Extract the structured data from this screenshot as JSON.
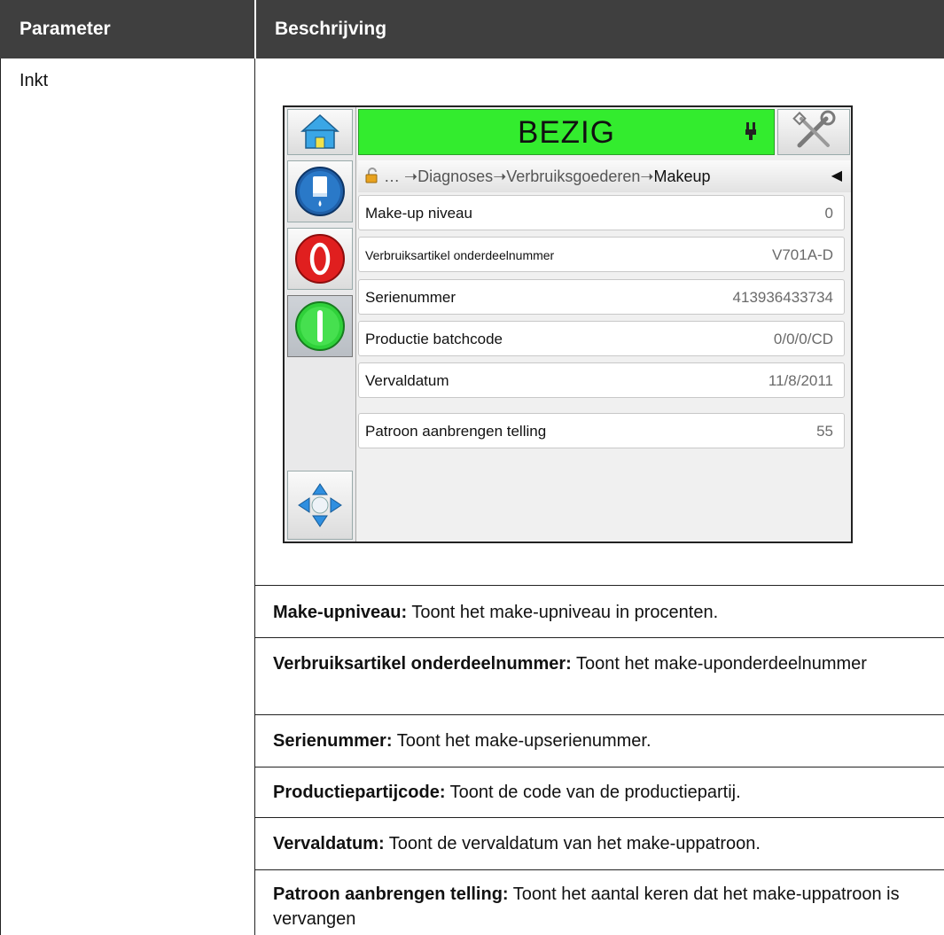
{
  "table": {
    "header": {
      "parameter": "Parameter",
      "description": "Beschrijving"
    },
    "parameter_value": "Inkt",
    "descriptions": [
      {
        "term": "Make-upniveau:",
        "text": " Toont het make-upniveau in procenten."
      },
      {
        "term": "Verbruiksartikel onderdeelnummer:",
        "text": " Toont het make-uponderdeelnummer"
      },
      {
        "term": "Serienummer:",
        "text": " Toont het make-upserienummer."
      },
      {
        "term": "Productiepartijcode:",
        "text": " Toont de code van de productiepartij."
      },
      {
        "term": "Vervaldatum:",
        "text": " Toont de vervaldatum van het make-uppatroon."
      },
      {
        "term": "Patroon aanbrengen telling:",
        "text": " Toont het aantal keren dat het make-uppatroon is vervangen"
      }
    ]
  },
  "screen": {
    "status": {
      "text": "BEZIG",
      "color": "#33ec2e"
    },
    "breadcrumb": {
      "ellipsis": "…",
      "sep": "➝",
      "items": [
        "Diagnoses",
        "Verbruiksgoederen"
      ],
      "current": "Makeup",
      "back": "◀"
    },
    "icons": {
      "home": "home-icon",
      "tools": "tools-icon",
      "status": "printhead-icon",
      "lock": "lock-icon",
      "left": [
        "ink-bottle-icon",
        "stop-icon",
        "start-icon",
        "navigation-arrows-icon"
      ]
    },
    "rows": [
      {
        "label": "Make-up niveau",
        "value": "0"
      },
      {
        "label": "Verbruiksartikel onderdeelnummer",
        "value": "V701A-D"
      },
      {
        "label": "Serienummer",
        "value": "413936433734"
      },
      {
        "label": "Productie batchcode",
        "value": "0/0/0/CD"
      },
      {
        "label": "Vervaldatum",
        "value": "11/8/2011"
      },
      {
        "label": "Patroon aanbrengen telling",
        "value": "55"
      }
    ]
  }
}
